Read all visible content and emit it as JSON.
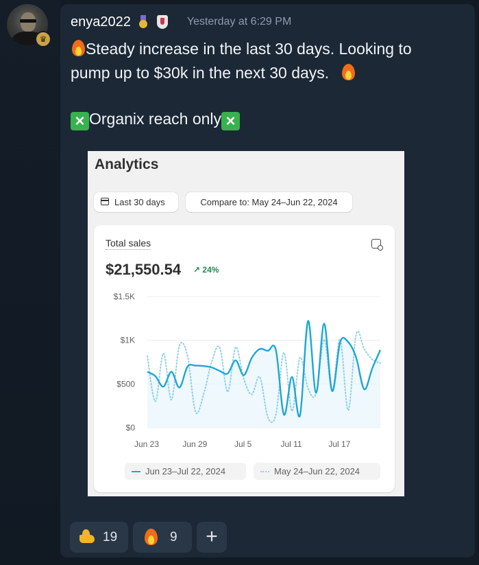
{
  "message": {
    "username": "enya2022",
    "timestamp": "Yesterday at 6:29 PM",
    "line1": "Steady increase in the last 30 days. Looking to",
    "line2": "pump up to $30k in the next 30 days.",
    "line3": "Organix reach only",
    "icons": [
      "avatar",
      "crown-icon",
      "medal-icon",
      "shield-icon",
      "fire-icon",
      "cross-mark-icon"
    ]
  },
  "analytics": {
    "title": "Analytics",
    "date_range": "Last 30 days",
    "compare": "Compare to: May 24–Jun 22, 2024",
    "total_label": "Total sales",
    "total_value": "$21,550.54",
    "trend": "↗ 24%",
    "colors": {
      "current": "#1fa6d6",
      "previous": "#8fd0e6",
      "trend": "#1f8a52"
    }
  },
  "chart_data": {
    "type": "line",
    "x_ticks": [
      "Jun 23",
      "Jun 29",
      "Jul 5",
      "Jul 11",
      "Jul 17"
    ],
    "y_ticks": [
      "$0",
      "$500",
      "$1K",
      "$1.5K"
    ],
    "ylim": [
      0,
      1500
    ],
    "grid": true,
    "legend_placement": "bottom",
    "series": [
      {
        "name": "Jun 23–Jul 22, 2024",
        "style": "solid",
        "values": [
          640,
          590,
          470,
          640,
          460,
          700,
          710,
          705,
          690,
          650,
          620,
          770,
          600,
          800,
          900,
          880,
          890,
          150,
          580,
          140,
          1220,
          400,
          1190,
          420,
          980,
          980,
          800,
          440,
          680,
          890
        ]
      },
      {
        "name": "May 24–Jun 22, 2024",
        "style": "dotted",
        "values": [
          820,
          300,
          850,
          320,
          940,
          820,
          180,
          380,
          750,
          920,
          410,
          920,
          560,
          380,
          580,
          120,
          150,
          860,
          190,
          800,
          450,
          390,
          1010,
          420,
          1010,
          200,
          1070,
          900,
          780,
          740
        ]
      }
    ]
  },
  "reactions": [
    {
      "emoji": "flexed-biceps-icon",
      "count": "19"
    },
    {
      "emoji": "fire-icon",
      "count": "9"
    },
    {
      "emoji": "add-reaction-icon",
      "label": "+"
    }
  ]
}
